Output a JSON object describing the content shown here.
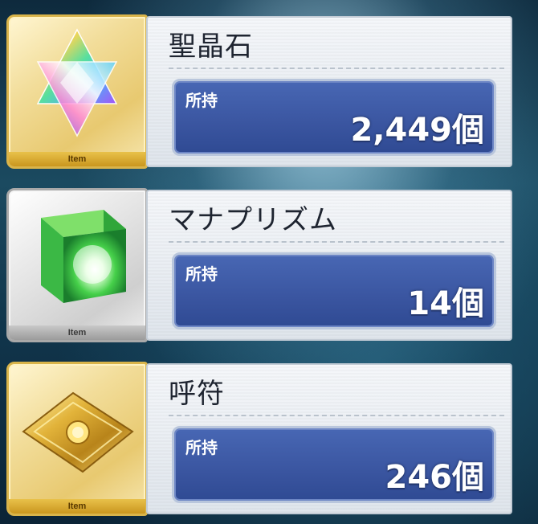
{
  "items": [
    {
      "name": "聖晶石",
      "owned_label": "所持",
      "count": "2,449個",
      "tag": "Item",
      "icon": "saint-quartz-star-icon"
    },
    {
      "name": "マナプリズム",
      "owned_label": "所持",
      "count": "14個",
      "tag": "Item",
      "icon": "mana-prism-cube-icon"
    },
    {
      "name": "呼符",
      "owned_label": "所持",
      "count": "246個",
      "tag": "Item",
      "icon": "summon-ticket-icon"
    }
  ]
}
